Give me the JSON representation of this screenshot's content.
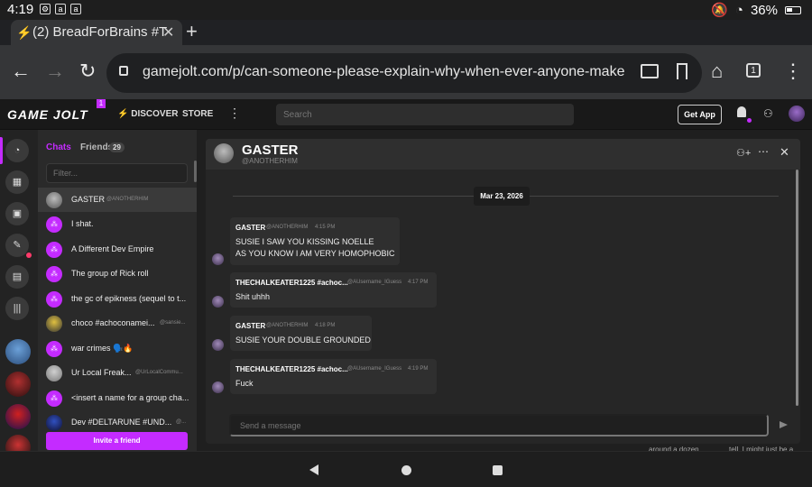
{
  "status_bar": {
    "time": "4:19",
    "notif_icons": [
      "settings-icon",
      "amazon-icon",
      "amazon-icon"
    ],
    "battery": "36%"
  },
  "browser": {
    "tab_title": "(2) BreadForBrains #T",
    "url": "gamejolt.com/p/can-someone-please-explain-why-when-ever-anyone-makes-a-is-pr",
    "tab_count": "1"
  },
  "gamejolt": {
    "logo": "GAME JOLT",
    "logo_badge": "1",
    "nav_discover": "DISCOVER",
    "nav_store": "STORE",
    "search_placeholder": "Search",
    "get_app": "Get App"
  },
  "chat_list": {
    "tab_chats": "Chats",
    "tab_friends": "Friends",
    "friends_count": "29",
    "filter_placeholder": "Filter...",
    "invite_label": "Invite a friend",
    "items": [
      {
        "name": "GASTER",
        "sub": "@ANOTHERHIM"
      },
      {
        "name": "I shat.",
        "sub": ""
      },
      {
        "name": "A Different Dev Empire",
        "sub": ""
      },
      {
        "name": "The group of Rick roll",
        "sub": ""
      },
      {
        "name": "the gc of epikness (sequel to t...",
        "sub": ""
      },
      {
        "name": "choco #achoconamei...",
        "sub": "@sansie..."
      },
      {
        "name": "war crimes 🗣️🔥",
        "sub": ""
      },
      {
        "name": "Ur Local Freak...",
        "sub": "@UrLocalCommu..."
      },
      {
        "name": "<insert a name for a group cha...",
        "sub": ""
      },
      {
        "name": "Dev #DELTARUNE #UND...",
        "sub": "@..."
      }
    ]
  },
  "chat_window": {
    "title": "GASTER",
    "handle": "@ANOTHERHIM",
    "date_separator": "Mar 23, 2026",
    "composer_placeholder": "Send a message",
    "messages": [
      {
        "author": "GASTER",
        "handle": "@ANOTHERHIM",
        "time": "4:15 PM",
        "lines": [
          "SUSIE I SAW YOU KISSING NOELLE",
          "AS YOU KNOW I AM VERY HOMOPHOBIC"
        ]
      },
      {
        "author": "THECHALKEATER1225 #achoc...",
        "handle": "@AUsername_IGuess",
        "time": "4:17 PM",
        "lines": [
          "Shit uhhh"
        ]
      },
      {
        "author": "GASTER",
        "handle": "@ANOTHERHIM",
        "time": "4:18 PM",
        "lines": [
          "SUSIE YOUR DOUBLE GROUNDED"
        ]
      },
      {
        "author": "THECHALKEATER1225 #achoc...",
        "handle": "@AUsername_IGuess",
        "time": "4:19 PM",
        "lines": [
          "Fuck"
        ]
      }
    ]
  },
  "background_text": {
    "left": "around a dozen",
    "right": "tell. I might just be a"
  },
  "colors": {
    "accent": "#c42bff",
    "panel": "#2a2a2a",
    "background": "#1f1f1f"
  }
}
